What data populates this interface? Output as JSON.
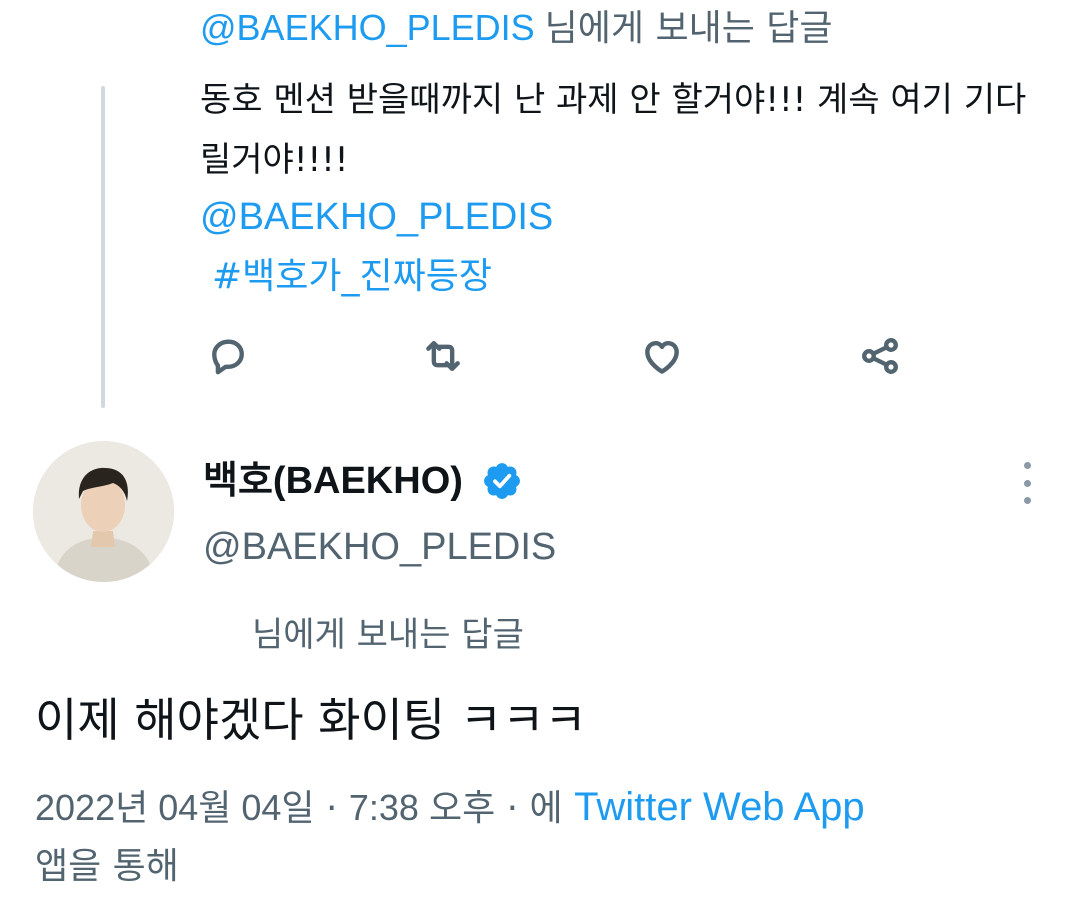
{
  "parent_tweet": {
    "reply_to": {
      "handle": "@BAEKHO_PLEDIS",
      "suffix": "님에게 보내는 답글"
    },
    "text": "동호 멘션 받을때까지 난 과제 안 할거야!!! 계속 여기 기다릴거야!!!!",
    "mention": "@BAEKHO_PLEDIS",
    "hashtag": "#백호가_진짜등장",
    "actions": [
      "reply-icon",
      "retweet-icon",
      "like-icon",
      "share-icon"
    ]
  },
  "main_tweet": {
    "display_name": "백호(BAEKHO)",
    "verified": true,
    "handle": "@BAEKHO_PLEDIS",
    "reply_to_suffix": "님에게 보내는 답글",
    "text": "이제 해야겠다 화이팅 ㅋㅋㅋ",
    "date": "2022년 04월 04일",
    "time": "7:38 오후",
    "source_prefix": "에",
    "source": "Twitter Web App",
    "source_suffix": "앱을 통해"
  },
  "colors": {
    "accent": "#1d9bf0",
    "secondary_text": "#536471",
    "thread_line": "#cfd9de"
  }
}
